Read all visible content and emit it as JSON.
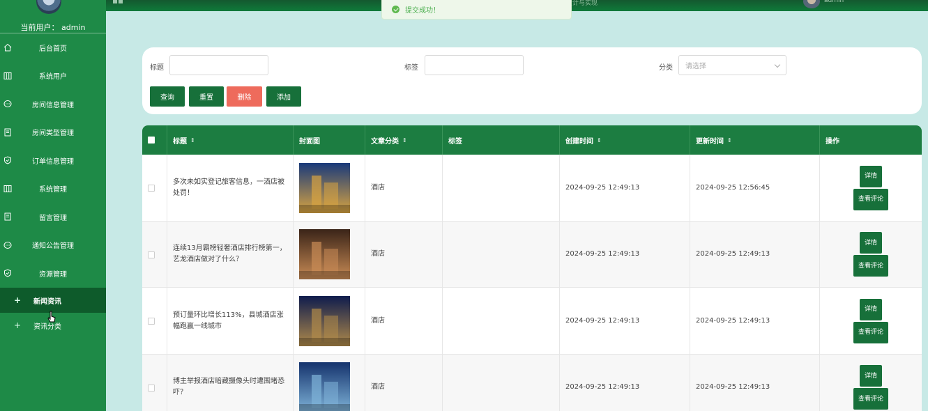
{
  "sidebar": {
    "current_user": "当前用户：  admin",
    "menu": [
      {
        "label": "后台首页",
        "icon": "home-icon"
      },
      {
        "label": "系统用户",
        "icon": "columns-icon"
      },
      {
        "label": "房间信息管理",
        "icon": "chat-icon"
      },
      {
        "label": "房间类型管理",
        "icon": "document-icon"
      },
      {
        "label": "订单信息管理",
        "icon": "shield-icon"
      },
      {
        "label": "系统管理",
        "icon": "columns-icon"
      },
      {
        "label": "留言管理",
        "icon": "document-icon"
      },
      {
        "label": "通知公告管理",
        "icon": "chat-icon"
      },
      {
        "label": "资源管理",
        "icon": "shield-icon"
      }
    ],
    "submenu": [
      {
        "label": "新闻资讯",
        "active": true
      },
      {
        "label": "资讯分类",
        "active": false
      }
    ],
    "plus": "+"
  },
  "topbar": {
    "title": "设计与实现",
    "user": "admin"
  },
  "toast": {
    "message": "提交成功！"
  },
  "filter": {
    "title_label": "标题",
    "tag_label": "标签",
    "category_label": "分类",
    "category_placeholder": "请选择",
    "buttons": {
      "search": "查询",
      "reset": "重置",
      "delete": "删除",
      "add": "添加"
    }
  },
  "table": {
    "columns": {
      "title": "标题",
      "cover": "封面图",
      "category": "文章分类",
      "tags": "标签",
      "created": "创建时间",
      "updated": "更新时间",
      "actions": "操作"
    },
    "sort_icon": "⇕",
    "rows": [
      {
        "title": "多次未如实登记旅客信息，一酒店被处罚！",
        "category": "酒店",
        "tags": "",
        "created": "2024-09-25 12:49:13",
        "updated": "2024-09-25 12:56:45",
        "cover_colors": [
          "#1a3a7a",
          "#d9a441"
        ]
      },
      {
        "title": "连续13月霸榜轻奢酒店排行榜第一，艺龙酒店做对了什么？",
        "category": "酒店",
        "tags": "",
        "created": "2024-09-25 12:49:13",
        "updated": "2024-09-25 12:49:13",
        "cover_colors": [
          "#3a2418",
          "#c98b55"
        ]
      },
      {
        "title": "预订量环比增长113%，县城酒店涨幅跑赢一线城市",
        "category": "酒店",
        "tags": "",
        "created": "2024-09-25 12:49:13",
        "updated": "2024-09-25 12:49:13",
        "cover_colors": [
          "#0f1c4d",
          "#b08a4a"
        ]
      },
      {
        "title": "博主举报酒店暗藏摄像头时遭围堵恐吓？",
        "category": "酒店",
        "tags": "",
        "created": "2024-09-25 12:49:13",
        "updated": "2024-09-25 12:49:13",
        "cover_colors": [
          "#15336d",
          "#7fb3d8"
        ]
      }
    ],
    "actions": {
      "detail": "详情",
      "comments": "查看评论"
    }
  },
  "colors": {
    "sidebar": "#1e8a47",
    "active": "#0e5b2b",
    "primary_button": "#17703a",
    "danger_button": "#ee6b5c",
    "background": "#c7e9e6"
  }
}
